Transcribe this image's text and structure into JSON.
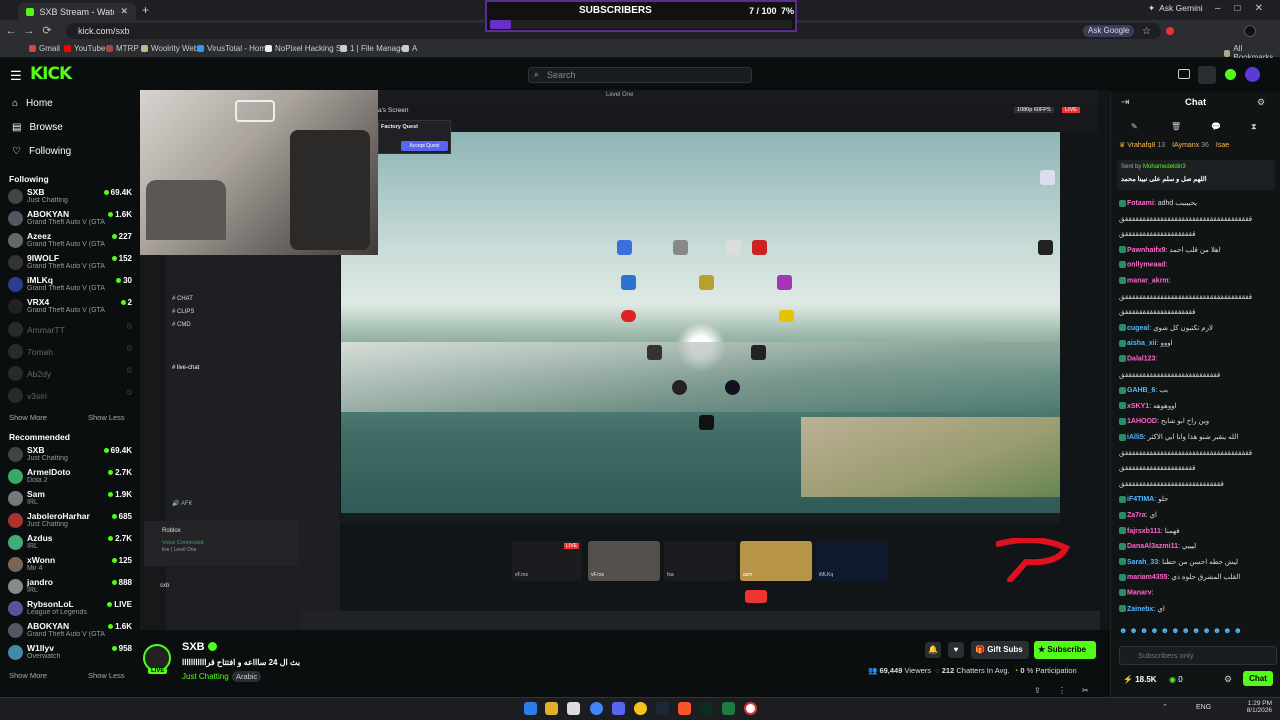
{
  "browser": {
    "tab_title": "SXB Stream - Watch Live on Kick",
    "url": "kick.com/sxb",
    "ask_google": "Ask Google",
    "ask_gemini": "Ask Gemini",
    "all_bookmarks": "All Bookmarks",
    "bookmarks": [
      "Gmail",
      "YouTube",
      "MTRP",
      "Woolrity Web",
      "VirusTotal - Home",
      "NoPixel Hacking S...",
      "1 | File Manager",
      "A"
    ]
  },
  "overlay": {
    "subscribers_label": "SUBSCRIBERS",
    "subscribers_count": "7 / 100",
    "subscribers_pct": "7%",
    "progress_fraction": 0.07
  },
  "header": {
    "logo": "KICK",
    "search_placeholder": "Search"
  },
  "sidebar": {
    "nav": [
      {
        "label": "Home",
        "icon": "home-icon"
      },
      {
        "label": "Browse",
        "icon": "browse-icon"
      },
      {
        "label": "Following",
        "icon": "heart-icon"
      }
    ],
    "following_title": "Following",
    "following": [
      {
        "name": "SXB",
        "sub": "Just Chatting",
        "viewers": "69.4K",
        "color": "#444"
      },
      {
        "name": "ABOKYAN",
        "sub": "Grand Theft Auto V (GTA)",
        "viewers": "1.6K",
        "color": "#556"
      },
      {
        "name": "Azeez",
        "sub": "Grand Theft Auto V (GTA)",
        "viewers": "227",
        "color": "#666"
      },
      {
        "name": "9IWOLF",
        "sub": "Grand Theft Auto V (GTA)",
        "viewers": "152",
        "color": "#333"
      },
      {
        "name": "iMLKq",
        "sub": "Grand Theft Auto V (GTA)",
        "viewers": "30",
        "color": "#2a3d8f"
      },
      {
        "name": "VRX4",
        "sub": "Grand Theft Auto V (GTA)",
        "viewers": "2",
        "color": "#222"
      }
    ],
    "offline": [
      "AmmarTT",
      "7omah",
      "Ab2dy",
      "v3siri"
    ],
    "show_more": "Show More",
    "show_less": "Show Less",
    "recommended_title": "Recommended",
    "recommended": [
      {
        "name": "SXB",
        "sub": "Just Chatting",
        "viewers": "69.4K",
        "color": "#444"
      },
      {
        "name": "ArmelDoto",
        "sub": "Dota 2",
        "viewers": "2.7K",
        "color": "#3a6"
      },
      {
        "name": "Sam",
        "sub": "IRL",
        "viewers": "1.9K",
        "color": "#777"
      },
      {
        "name": "JaboleroHarhar",
        "sub": "Just Chatting",
        "viewers": "685",
        "color": "#a33"
      },
      {
        "name": "Azdus",
        "sub": "IRL",
        "viewers": "2.7K",
        "color": "#4a7"
      },
      {
        "name": "xWonn",
        "sub": "Mir 4",
        "viewers": "125",
        "color": "#765"
      },
      {
        "name": "jandro",
        "sub": "IRL",
        "viewers": "888",
        "color": "#888"
      },
      {
        "name": "RybsonLoL",
        "sub": "League of Legends",
        "viewers": "LIVE",
        "color": "#559"
      },
      {
        "name": "ABOKYAN",
        "sub": "Grand Theft Auto V (GTA)",
        "viewers": "1.6K",
        "color": "#556"
      },
      {
        "name": "W1llyv",
        "sub": "Overwatch",
        "viewers": "958",
        "color": "#48a"
      }
    ]
  },
  "player": {
    "window_title": "Level One",
    "screen_title": "a's Screen",
    "quality": "1080p 60FPS",
    "live": "LIVE",
    "quest_title": "Factory Quest",
    "quest_button": "Accept Quest",
    "discord": {
      "channels": [
        "CHAT",
        "CLIPS",
        "CMD"
      ],
      "live_channel": "live-chat",
      "voice_connected": "Voice Connected",
      "voice_sub": "live | Level One",
      "roblox": "Roblox",
      "user": "sxb",
      "afk": "AFK"
    },
    "call_tiles": [
      "vF.rxs",
      "vF.rxs",
      "fxa",
      "azm",
      "iMLKq"
    ]
  },
  "stream": {
    "name": "SXB",
    "title": "بث ال 24 ساااعه و افتتاح قرااااااااااا",
    "category": "Just Chatting",
    "tag": "Arabic",
    "viewers": "69,449",
    "viewers_label": "Viewers",
    "chatters": "212",
    "chatters_label": "Chatters In Avg.",
    "participation": "0",
    "participation_label": "% Participation",
    "gift_subs": "Gift Subs",
    "subscribe": "Subscribe"
  },
  "chat": {
    "title": "Chat",
    "top_gifters": [
      {
        "name": "Vrahafq8",
        "count": "13"
      },
      {
        "name": "IAymanx",
        "count": "36"
      },
      {
        "name": "Isae",
        "count": ""
      }
    ],
    "pinned_sent_by": "Sent by",
    "pinned_user": "Mohamedeldin3",
    "pinned_text": "اللهم صل و سلم على نبينا محمد",
    "messages": [
      {
        "user": "Fotaami",
        "text": "adhd يحببببب",
        "color": "#ff66cc"
      },
      {
        "user": "",
        "text": "ققققققققققققققققققققققققققققققققققققق",
        "color": "#ddd"
      },
      {
        "user": "",
        "text": "ققققققققققققققققققققق",
        "color": "#ddd"
      },
      {
        "user": "Pawnhaifx9",
        "text": "اهلا من قلب احمد",
        "color": "#ff66cc"
      },
      {
        "user": "onllymeaad",
        "text": "",
        "color": "#ff66cc"
      },
      {
        "user": "manar_akrm",
        "text": "",
        "color": "#ff66cc"
      },
      {
        "user": "",
        "text": "ققققققققققققققققققققققققققققققققققققق",
        "color": "#ddd"
      },
      {
        "user": "",
        "text": "ققققققققققققققققققققق",
        "color": "#ddd"
      },
      {
        "user": "cugeal",
        "text": "لازم تكتبون كل شوي",
        "color": "#53b9ff"
      },
      {
        "user": "aisha_xii",
        "text": "اووو",
        "color": "#53b9ff"
      },
      {
        "user": "Dalal123",
        "text": "",
        "color": "#ff66cc"
      },
      {
        "user": "",
        "text": "قققققققققققققققققققققققققققق",
        "color": "#ddd"
      },
      {
        "user": "GAHB_6",
        "text": "بب",
        "color": "#53b9ff"
      },
      {
        "user": "xSKY1",
        "text": "اووهوهه",
        "color": "#ff66cc"
      },
      {
        "user": "1AHOOD",
        "text": "وين راح ابو شابح",
        "color": "#ff66cc"
      },
      {
        "user": "iAlli5",
        "text": "الله ينقبر شنو هذا وانا ابي الاكثر",
        "color": "#53b9ff"
      },
      {
        "user": "",
        "text": "ققققققققققققققققققققققققققققققققققققق",
        "color": "#ddd"
      },
      {
        "user": "",
        "text": "ققققققققققققققققققققق",
        "color": "#ddd"
      },
      {
        "user": "",
        "text": "ققققققققققققققققققققققققققققق",
        "color": "#ddd"
      },
      {
        "user": "iF4TIMA",
        "text": "حلو",
        "color": "#53b9ff"
      },
      {
        "user": "Za7ra",
        "text": "اي",
        "color": "#ff66cc"
      },
      {
        "user": "fajrsxb111",
        "text": "فهمنا",
        "color": "#ff66cc"
      },
      {
        "user": "DanaAl3azmi11",
        "text": "ليييي",
        "color": "#ff66cc"
      },
      {
        "user": "Sarah_33",
        "text": "ليش حطه احسن من حطنا",
        "color": "#53b9ff"
      },
      {
        "user": "mariam4355",
        "text": "القلب المشرق حلوه ذي",
        "color": "#ff66cc"
      },
      {
        "user": "Manarv",
        "text": "",
        "color": "#ff66cc"
      },
      {
        "user": "Zainebx",
        "text": "اي",
        "color": "#53b9ff"
      }
    ],
    "input_placeholder": "Subscribers only",
    "kicks": "18.5K",
    "points": "0",
    "send": "Chat"
  },
  "taskbar": {
    "lang": "ENG",
    "time": "1:29 PM",
    "date": "8/1/2026"
  }
}
